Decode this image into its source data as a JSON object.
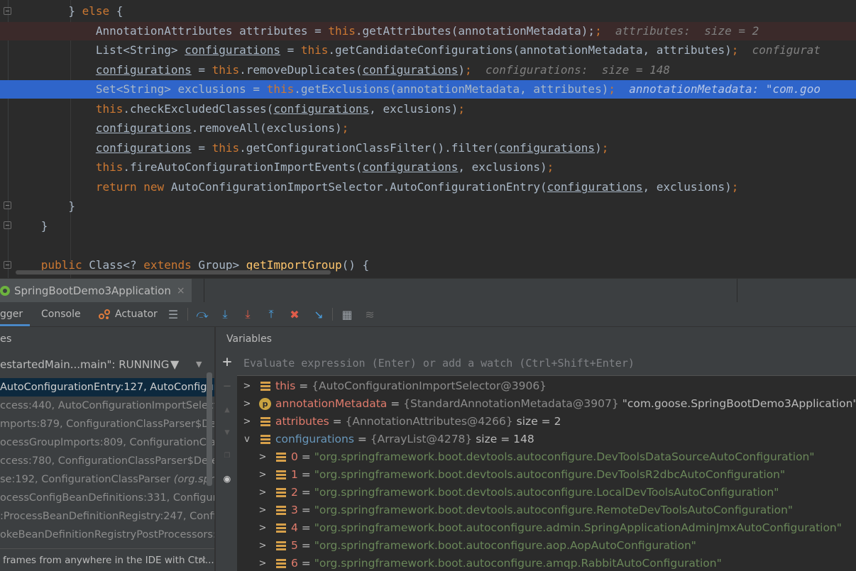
{
  "editor": {
    "lines": [
      {
        "id": "else",
        "hint": ""
      },
      {
        "id": "attrs",
        "hint": "attributes:  size = 2"
      },
      {
        "id": "configs",
        "hint": "configurat"
      },
      {
        "id": "dedup",
        "hint": "configurations:  size = 148"
      },
      {
        "id": "excl",
        "hint": "annotationMetadata: \"com.goo"
      }
    ]
  },
  "run_tab": {
    "label": "SpringBootDemo3Application",
    "close": "×"
  },
  "debug_tabs": {
    "debugger": "gger",
    "console": "Console",
    "actuator": "Actuator"
  },
  "frames_panel": {
    "header": "es",
    "thread": "estartedMain...main\": RUNNING",
    "frames": [
      {
        "text": "AutoConfigurationEntry:127, AutoConfigur",
        "italic": ""
      },
      {
        "text": "ccess:440, AutoConfigurationImportSelecto",
        "italic": ""
      },
      {
        "text": "mports:879, ConfigurationClassParser$De",
        "italic": ""
      },
      {
        "text": "ocessGroupImports:809, ConfigurationClass",
        "italic": ""
      },
      {
        "text": "ccess:780, ConfigurationClassParser$Deferr",
        "italic": ""
      },
      {
        "text": "se:192, ConfigurationClassParser ",
        "italic": "(org.sprin"
      },
      {
        "text": "ocessConfigBeanDefinitions:331, Configurat",
        "italic": ""
      },
      {
        "text": ":ProcessBeanDefinitionRegistry:247, Confi",
        "italic": ""
      },
      {
        "text": "okeBeanDefinitionRegistryPostProcessors:",
        "italic": ""
      }
    ],
    "tip": "frames from anywhere in the IDE with Ctrl...",
    "tip_close": "×"
  },
  "variables": {
    "header": "Variables",
    "eval_placeholder": "Evaluate expression (Enter) or add a watch (Ctrl+Shift+Enter)",
    "rows": [
      {
        "name": "this",
        "type": "{AutoConfigurationImportSelector@3906}",
        "extra": ""
      },
      {
        "name": "annotationMetadata",
        "type": "{StandardAnnotationMetadata@3907}",
        "extra": "\"com.goose.SpringBootDemo3Application\""
      },
      {
        "name": "attributes",
        "type": "{AnnotationAttributes@4266}",
        "extra": "size = 2"
      },
      {
        "name": "configurations",
        "type": "{ArrayList@4278}",
        "extra": "size = 148"
      }
    ],
    "children": [
      {
        "idx": "0",
        "value": "\"org.springframework.boot.devtools.autoconfigure.DevToolsDataSourceAutoConfiguration\""
      },
      {
        "idx": "1",
        "value": "\"org.springframework.boot.devtools.autoconfigure.DevToolsR2dbcAutoConfiguration\""
      },
      {
        "idx": "2",
        "value": "\"org.springframework.boot.devtools.autoconfigure.LocalDevToolsAutoConfiguration\""
      },
      {
        "idx": "3",
        "value": "\"org.springframework.boot.devtools.autoconfigure.RemoteDevToolsAutoConfiguration\""
      },
      {
        "idx": "4",
        "value": "\"org.springframework.boot.autoconfigure.admin.SpringApplicationAdminJmxAutoConfiguration\""
      },
      {
        "idx": "5",
        "value": "\"org.springframework.boot.autoconfigure.aop.AopAutoConfiguration\""
      },
      {
        "idx": "6",
        "value": "\"org.springframework.boot.autoconfigure.amqp.RabbitAutoConfiguration\""
      }
    ]
  }
}
